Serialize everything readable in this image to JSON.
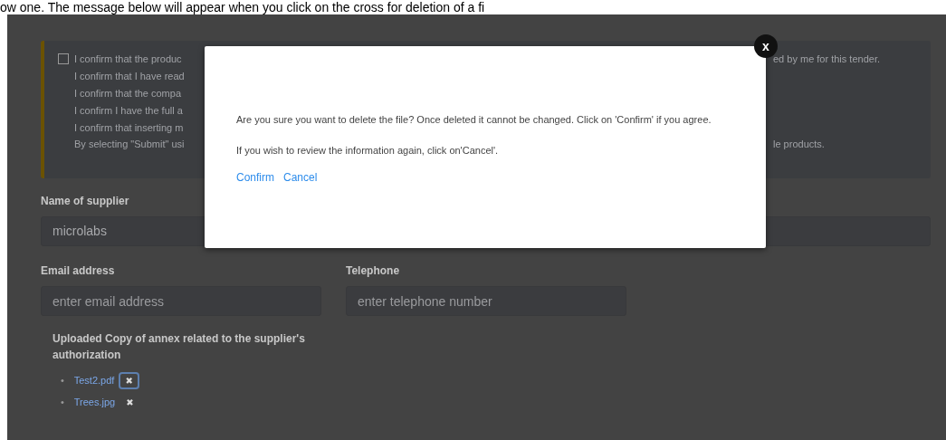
{
  "caption": "ow one. The message below will appear when you click on the cross for deletion of a fi",
  "declaration": {
    "checked": false,
    "lines": [
      {
        "left": "I confirm that the produc",
        "right": "ed by me for this tender."
      },
      {
        "left": "I confirm that I have read"
      },
      {
        "left": "I confirm that the compa"
      },
      {
        "left": "I confirm I have the full a"
      },
      {
        "left": "I confirm that inserting m"
      },
      {
        "left": "By selecting \"Submit\" usi",
        "right": "le products."
      }
    ]
  },
  "supplier": {
    "label": "Name of supplier",
    "value": "microlabs"
  },
  "email": {
    "label": "Email address",
    "placeholder": "enter email address"
  },
  "telephone": {
    "label": "Telephone",
    "placeholder": "enter telephone number"
  },
  "uploads": {
    "heading": "Uploaded Copy of annex related to the supplier's authorization",
    "files": [
      {
        "bullet": "•",
        "name": "Test2.pdf",
        "remove": "✖",
        "focused": true
      },
      {
        "bullet": "•",
        "name": "Trees.jpg",
        "remove": "✖",
        "focused": false
      }
    ]
  },
  "dialog": {
    "close": "x",
    "message": "Are you sure you want to delete the file? Once deleted it cannot be changed. Click on 'Confirm' if you agree.",
    "hint": "If you wish to review the information again, click on'Cancel'.",
    "actions": [
      "Confirm",
      "Cancel"
    ]
  }
}
